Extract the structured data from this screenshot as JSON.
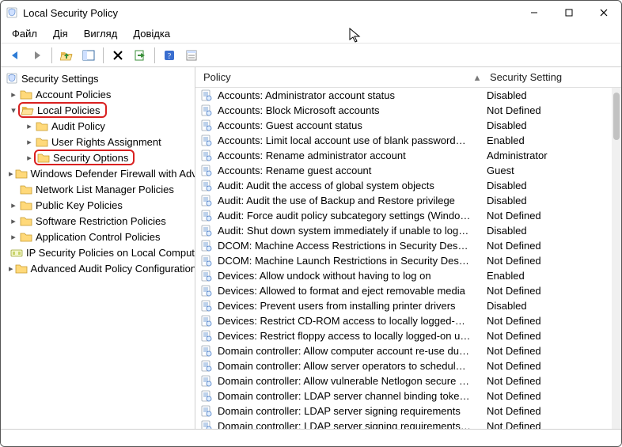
{
  "window": {
    "title": "Local Security Policy"
  },
  "menu": {
    "items": [
      "Файл",
      "Дія",
      "Вигляд",
      "Довідка"
    ]
  },
  "tree": {
    "root": "Security Settings",
    "n_account": "Account Policies",
    "n_local": "Local Policies",
    "n_audit": "Audit Policy",
    "n_ura": "User Rights Assignment",
    "n_secopt": "Security Options",
    "n_wdf": "Windows Defender Firewall with Advanced Security",
    "n_nlmp": "Network List Manager Policies",
    "n_pkp": "Public Key Policies",
    "n_srp": "Software Restriction Policies",
    "n_acp": "Application Control Policies",
    "n_ipsec": "IP Security Policies on Local Computer",
    "n_aapc": "Advanced Audit Policy Configuration"
  },
  "list": {
    "col_policy": "Policy",
    "col_setting": "Security Setting",
    "rows": [
      {
        "p": "Accounts: Administrator account status",
        "s": "Disabled"
      },
      {
        "p": "Accounts: Block Microsoft accounts",
        "s": "Not Defined"
      },
      {
        "p": "Accounts: Guest account status",
        "s": "Disabled"
      },
      {
        "p": "Accounts: Limit local account use of blank passwords to console logon only",
        "s": "Enabled"
      },
      {
        "p": "Accounts: Rename administrator account",
        "s": "Administrator"
      },
      {
        "p": "Accounts: Rename guest account",
        "s": "Guest"
      },
      {
        "p": "Audit: Audit the access of global system objects",
        "s": "Disabled"
      },
      {
        "p": "Audit: Audit the use of Backup and Restore privilege",
        "s": "Disabled"
      },
      {
        "p": "Audit: Force audit policy subcategory settings (Windows Vista or later) to override audit policy category settings",
        "s": "Not Defined"
      },
      {
        "p": "Audit: Shut down system immediately if unable to log security audits",
        "s": "Disabled"
      },
      {
        "p": "DCOM: Machine Access Restrictions in Security Descriptor Definition Language (SDDL) syntax",
        "s": "Not Defined"
      },
      {
        "p": "DCOM: Machine Launch Restrictions in Security Descriptor Definition Language (SDDL) syntax",
        "s": "Not Defined"
      },
      {
        "p": "Devices: Allow undock without having to log on",
        "s": "Enabled"
      },
      {
        "p": "Devices: Allowed to format and eject removable media",
        "s": "Not Defined"
      },
      {
        "p": "Devices: Prevent users from installing printer drivers",
        "s": "Disabled"
      },
      {
        "p": "Devices: Restrict CD-ROM access to locally logged-on user only",
        "s": "Not Defined"
      },
      {
        "p": "Devices: Restrict floppy access to locally logged-on user only",
        "s": "Not Defined"
      },
      {
        "p": "Domain controller: Allow computer account re-use during domain join",
        "s": "Not Defined"
      },
      {
        "p": "Domain controller: Allow server operators to schedule tasks",
        "s": "Not Defined"
      },
      {
        "p": "Domain controller: Allow vulnerable Netlogon secure channel connections",
        "s": "Not Defined"
      },
      {
        "p": "Domain controller: LDAP server channel binding token requirements",
        "s": "Not Defined"
      },
      {
        "p": "Domain controller: LDAP server signing requirements",
        "s": "Not Defined"
      },
      {
        "p": "Domain controller: LDAP server signing requirements Enforced",
        "s": "Not Defined"
      }
    ]
  }
}
